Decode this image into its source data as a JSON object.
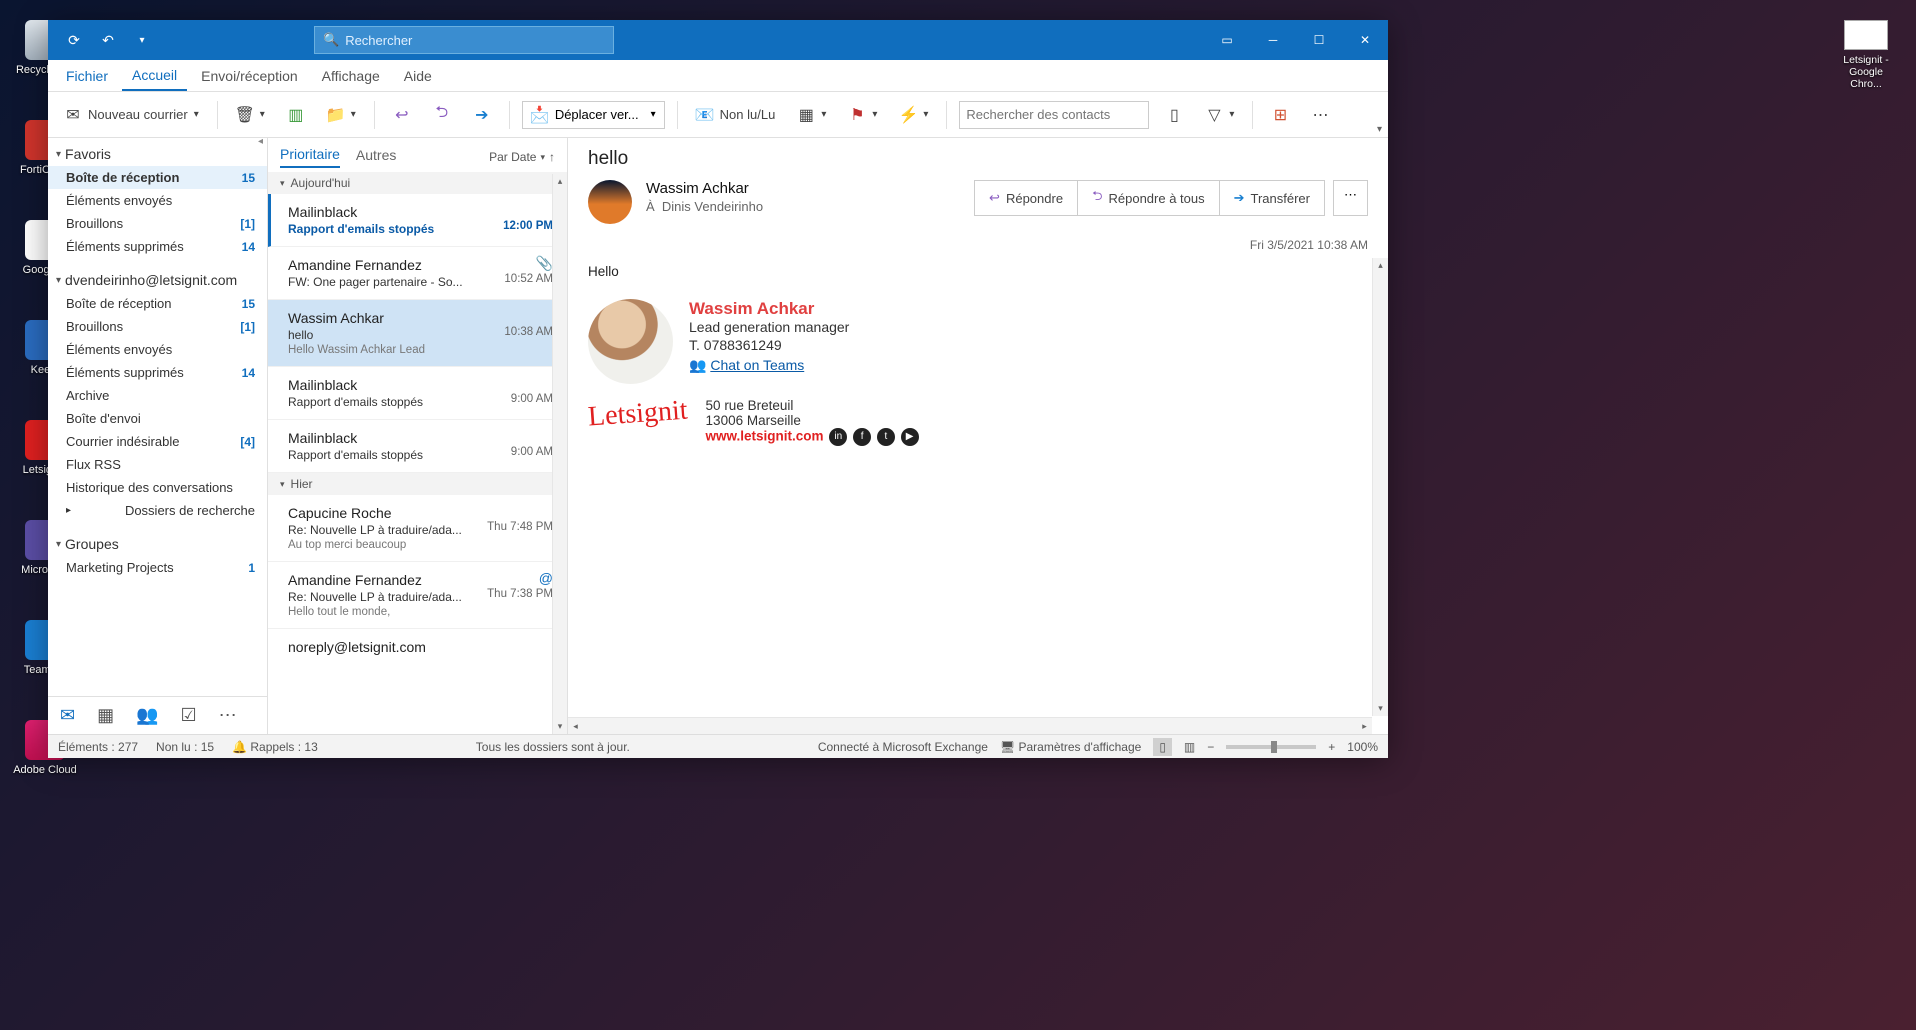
{
  "desktop_icons": {
    "recycle_bin": "Recycle Bin",
    "forticlient": "FortiClie...",
    "google": "Google...",
    "kee": "Kee...",
    "letsignit": "Letsign...",
    "microsoft": "Microso...",
    "teamv": "TeamV...",
    "adobe": "Adobe Cloud"
  },
  "secondary_window": {
    "line1": "Letsignit -",
    "line2": "Google Chro..."
  },
  "titlebar": {
    "search_placeholder": "Rechercher"
  },
  "menubar": {
    "fichier": "Fichier",
    "accueil": "Accueil",
    "envoi": "Envoi/réception",
    "affichage": "Affichage",
    "aide": "Aide"
  },
  "ribbon": {
    "new_mail": "Nouveau courrier",
    "move": "Déplacer ver...",
    "unread": "Non lu/Lu",
    "contacts_placeholder": "Rechercher des contacts"
  },
  "folders": {
    "favoris": "Favoris",
    "inbox": "Boîte de réception",
    "inbox_cnt": "15",
    "sent": "Éléments envoyés",
    "drafts": "Brouillons",
    "drafts_cnt": "[1]",
    "deleted": "Éléments supprimés",
    "deleted_cnt": "14",
    "account": "dvendeirinho@letsignit.com",
    "inbox2": "Boîte de réception",
    "inbox2_cnt": "15",
    "drafts2": "Brouillons",
    "drafts2_cnt": "[1]",
    "sent2": "Éléments envoyés",
    "deleted2": "Éléments supprimés",
    "deleted2_cnt": "14",
    "archive": "Archive",
    "outbox": "Boîte d'envoi",
    "junk": "Courrier indésirable",
    "junk_cnt": "[4]",
    "rss": "Flux RSS",
    "history": "Historique des conversations",
    "search_folders": "Dossiers de recherche",
    "groups": "Groupes",
    "marketing": "Marketing Projects",
    "marketing_cnt": "1"
  },
  "list_header": {
    "focused": "Prioritaire",
    "other": "Autres",
    "sort": "Par Date"
  },
  "groups_hdr": {
    "today": "Aujourd'hui",
    "yesterday": "Hier"
  },
  "messages": {
    "m1": {
      "sender": "Mailinblack",
      "subj": "Rapport d'emails stoppés",
      "time": "12:00 PM"
    },
    "m2": {
      "sender": "Amandine Fernandez",
      "subj": "FW: One pager partenaire - So...",
      "time": "10:52 AM"
    },
    "m3": {
      "sender": "Wassim Achkar",
      "subj": "hello",
      "prev": "Hello   Wassim Achkar   Lead",
      "time": "10:38 AM"
    },
    "m4": {
      "sender": "Mailinblack",
      "subj": "Rapport d'emails stoppés",
      "time": "9:00 AM"
    },
    "m5": {
      "sender": "Mailinblack",
      "subj": "Rapport d'emails stoppés",
      "time": "9:00 AM"
    },
    "m6": {
      "sender": "Capucine Roche",
      "subj": "Re: Nouvelle LP à traduire/ada...",
      "prev": "Au top merci beaucoup",
      "time": "Thu 7:48 PM"
    },
    "m7": {
      "sender": "Amandine Fernandez",
      "subj": "Re: Nouvelle LP à traduire/ada...",
      "prev": "Hello tout le monde,",
      "time": "Thu 7:38 PM"
    },
    "m8": {
      "sender": "noreply@letsignit.com"
    }
  },
  "reading": {
    "subject": "hello",
    "from": "Wassim Achkar",
    "to_label": "À",
    "to": "Dinis Vendeirinho",
    "reply": "Répondre",
    "reply_all": "Répondre à tous",
    "forward": "Transférer",
    "date": "Fri 3/5/2021 10:38 AM",
    "body_hello": "Hello",
    "sig": {
      "name": "Wassim Achkar",
      "role": "Lead generation manager",
      "tel": "T. 0788361249",
      "teams": "Chat on Teams",
      "logo": "Letsignit",
      "addr1": "50 rue Breteuil",
      "addr2": "13006 Marseille",
      "web": "www.letsignit.com"
    }
  },
  "status": {
    "elements": "Éléments : 277",
    "unread": "Non lu : 15",
    "reminders": "Rappels : 13",
    "folders": "Tous les dossiers sont à jour.",
    "connected": "Connecté à Microsoft Exchange",
    "display": "Paramètres d'affichage",
    "zoom": "100%"
  }
}
